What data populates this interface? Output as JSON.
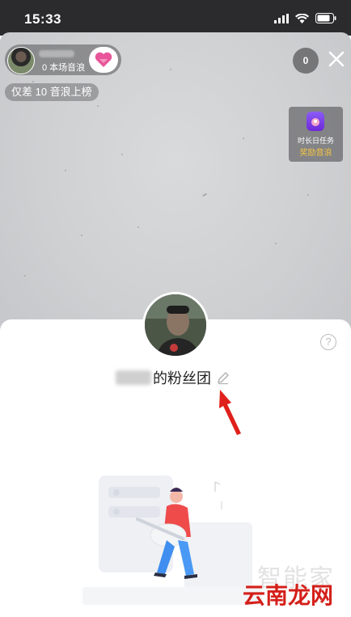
{
  "status_bar": {
    "time": "15:33"
  },
  "live_room": {
    "host": {
      "sub_label": "0 本场音浪"
    },
    "rank_tip": "仅差 10 音浪上榜",
    "viewer_count": "0",
    "task_card": {
      "line1": "时长日任务",
      "line2": "奖励音浪"
    }
  },
  "fan_club": {
    "title_suffix": "的粉丝团",
    "help_glyph": "?"
  },
  "watermark": {
    "faint": "智能家",
    "brand": "云南龙网"
  },
  "colors": {
    "arrow_red": "#e0201b",
    "task_gold": "#f5c542",
    "brand_red": "#d4201a"
  }
}
